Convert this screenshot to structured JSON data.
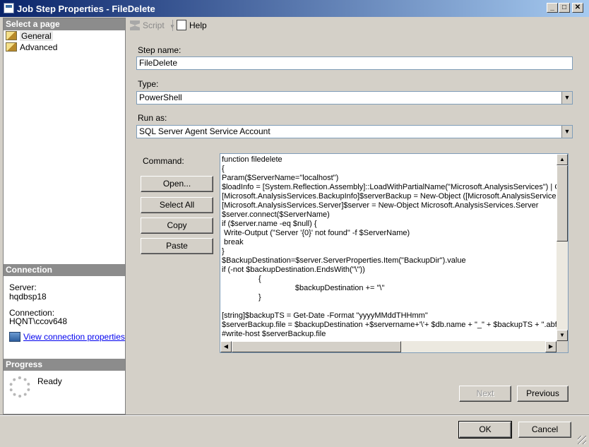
{
  "window": {
    "title": "Job Step Properties - FileDelete",
    "controls": {
      "minimize": "_",
      "maximize": "□",
      "close": "✕"
    }
  },
  "left_panel": {
    "select_page_header": "Select a page",
    "pages": [
      {
        "label": "General",
        "selected": true
      },
      {
        "label": "Advanced",
        "selected": false
      }
    ],
    "connection_header": "Connection",
    "server_label": "Server:",
    "server_value": "hqdbsp18",
    "connection_label": "Connection:",
    "connection_value": "HQNT\\ccov648",
    "view_connection_link": "View connection properties",
    "progress_header": "Progress",
    "progress_status": "Ready"
  },
  "toolbar": {
    "script_label": "Script",
    "help_label": "Help"
  },
  "form": {
    "step_name_label": "Step name:",
    "step_name_value": "FileDelete",
    "type_label": "Type:",
    "type_value": "PowerShell",
    "run_as_label": "Run as:",
    "run_as_value": "SQL Server Agent Service Account",
    "command_label": "Command:",
    "command_text": "function filedelete\n{\nParam($ServerName=\"localhost\")\n$loadInfo = [System.Reflection.Assembly]::LoadWithPartialName(\"Microsoft.AnalysisServices\") | Out-\n[Microsoft.AnalysisServices.BackupInfo]$serverBackup = New-Object ([Microsoft.AnalysisServices.B\n[Microsoft.AnalysisServices.Server]$server = New-Object Microsoft.AnalysisServices.Server\n$server.connect($ServerName)\nif ($server.name -eq $null) {\n Write-Output (\"Server '{0}' not found\" -f $ServerName)\n break\n}\n$BackupDestination=$server.ServerProperties.Item(\"BackupDir\").value\nif (-not $backupDestination.EndsWith(\"\\\"))\n                 {\n                                  $backupDestination += \"\\\"\n                 }\n\n[string]$backupTS = Get-Date -Format \"yyyyMMddTHHmm\"\n$serverBackup.file = $backupDestination +$servername+'\\'+ $db.name + \"_\" + $backupTS + \".abf\"\n#write-host $serverBackup.file",
    "buttons": {
      "open": "Open...",
      "select_all": "Select All",
      "copy": "Copy",
      "paste": "Paste"
    }
  },
  "navigation": {
    "next": "Next",
    "previous": "Previous"
  },
  "dialog_buttons": {
    "ok": "OK",
    "cancel": "Cancel"
  }
}
